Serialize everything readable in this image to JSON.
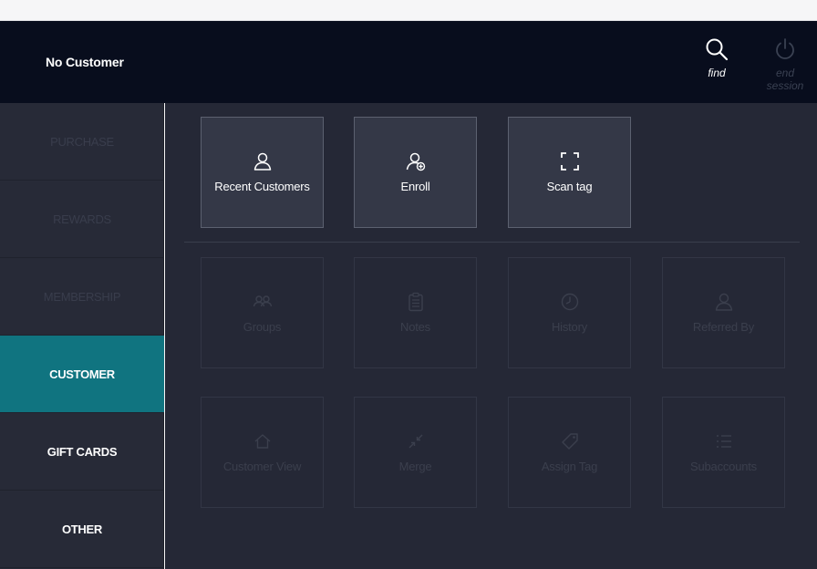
{
  "header": {
    "customer_name": "No Customer",
    "find_label": "find",
    "find_icon": "search-icon",
    "end_session_label": "end session",
    "end_session_icon": "power-icon"
  },
  "sidebar": {
    "items": [
      {
        "label": "PURCHASE",
        "state": "disabled"
      },
      {
        "label": "REWARDS",
        "state": "disabled"
      },
      {
        "label": "MEMBERSHIP",
        "state": "disabled"
      },
      {
        "label": "CUSTOMER",
        "state": "active"
      },
      {
        "label": "GIFT CARDS",
        "state": "enabled"
      },
      {
        "label": "OTHER",
        "state": "enabled"
      }
    ]
  },
  "actions": {
    "primary": [
      {
        "label": "Recent Customers",
        "icon": "user-icon"
      },
      {
        "label": "Enroll",
        "icon": "user-add-icon"
      },
      {
        "label": "Scan tag",
        "icon": "scan-icon"
      }
    ],
    "secondary": [
      {
        "label": "Groups",
        "icon": "group-icon"
      },
      {
        "label": "Notes",
        "icon": "clipboard-icon"
      },
      {
        "label": "History",
        "icon": "clock-icon"
      },
      {
        "label": "Referred By",
        "icon": "user-icon"
      },
      {
        "label": "Customer View",
        "icon": "home-icon"
      },
      {
        "label": "Merge",
        "icon": "merge-arrows-icon"
      },
      {
        "label": "Assign Tag",
        "icon": "tag-icon"
      },
      {
        "label": "Subaccounts",
        "icon": "list-icon"
      }
    ]
  },
  "colors": {
    "header_bg": "#080d1d",
    "sidebar_bg": "#272a37",
    "main_bg": "#252836",
    "active_accent": "#107480",
    "tile_bg": "#343847"
  }
}
